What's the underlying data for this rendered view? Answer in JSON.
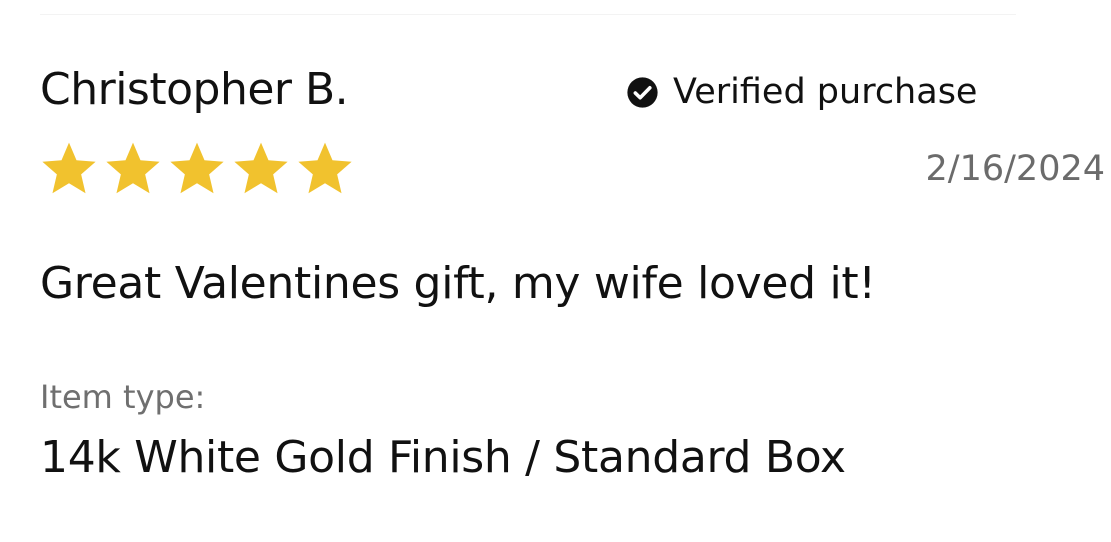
{
  "review": {
    "reviewer_name": "Christopher B.",
    "verified_label": "Verified purchase",
    "rating": 5,
    "rating_max": 5,
    "date": "2/16/2024",
    "body": "Great Valentines gift, my wife loved it!",
    "item_type_label": "Item type:",
    "item_type_value": "14k White Gold Finish / Standard Box"
  },
  "colors": {
    "star": "#F1C22E",
    "text": "#111111",
    "muted": "#6B6B6B"
  },
  "icons": {
    "verified": "check-circle-icon",
    "rating": "star-icon"
  }
}
